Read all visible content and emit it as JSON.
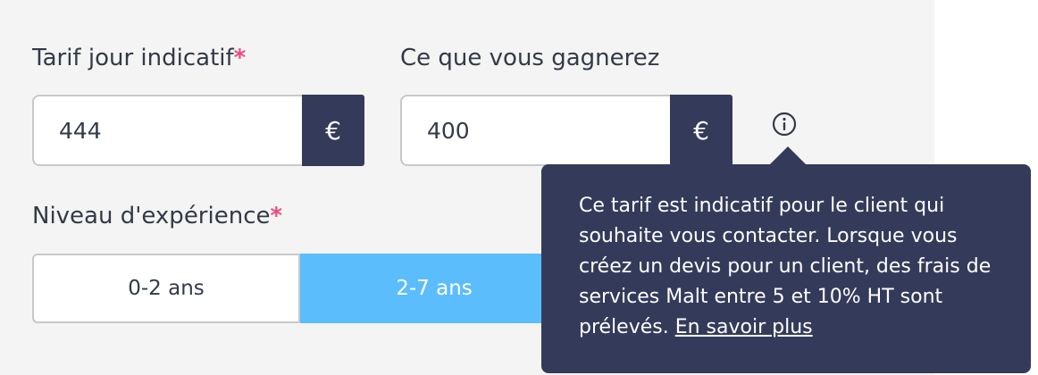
{
  "form": {
    "daily_rate": {
      "label": "Tarif jour indicatif",
      "required_mark": "*",
      "value": "444",
      "currency": "€"
    },
    "earnings": {
      "label": "Ce que vous gagnerez",
      "value": "400",
      "currency": "€"
    },
    "experience": {
      "label": "Niveau d'expérience",
      "required_mark": "*",
      "options": [
        "0-2 ans",
        "2-7 ans"
      ],
      "selected": "2-7 ans"
    }
  },
  "tooltip": {
    "text": "Ce tarif est indicatif pour le client qui souhaite vous contacter. Lorsque vous créez un devis pour un client, des frais de services Malt entre 5 et 10% HT sont prélevés.",
    "link_label": "En savoir plus"
  },
  "icons": {
    "info": "info-circle-icon"
  },
  "colors": {
    "primary_dark": "#343b5a",
    "selected_blue": "#5bbdfc",
    "required_pink": "#f04b7d"
  }
}
